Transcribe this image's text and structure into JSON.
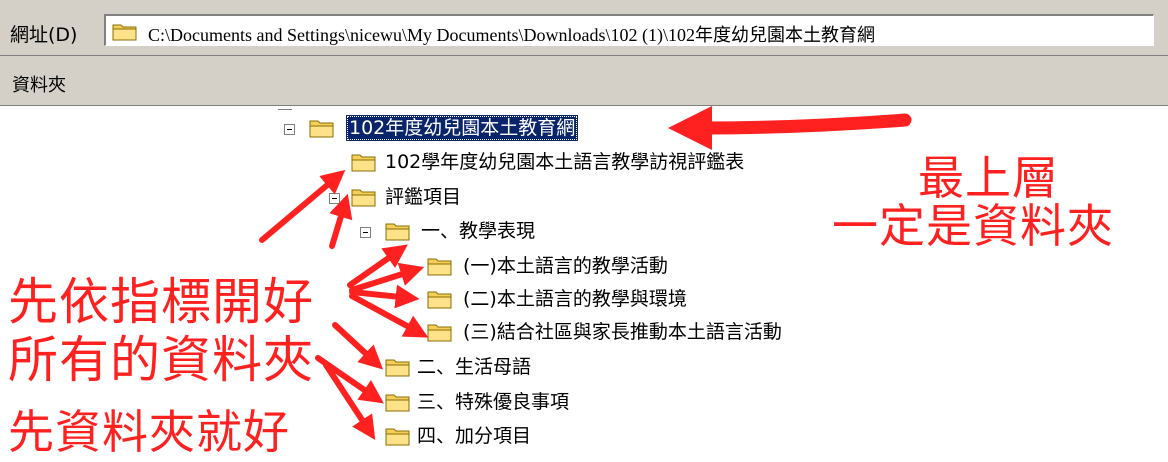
{
  "address_bar": {
    "label": "網址(D)",
    "path": "C:\\Documents and Settings\\nicewu\\My Documents\\Downloads\\102 (1)\\102年度幼兒園本土教育網"
  },
  "folders_panel": {
    "title": "資料夾"
  },
  "tree": {
    "root": "102年度幼兒園本土教育網",
    "form": "102學年度幼兒園本土語言教學訪視評鑑表",
    "eval_items": "評鑑項目",
    "teaching": "一、教學表現",
    "sub1": "(一)本土語言的教學活動",
    "sub2": "(二)本土語言的教學與環境",
    "sub3": "(三)結合社區與家長推動本土語言活動",
    "life": "二、生活母語",
    "special": "三、特殊優良事項",
    "bonus": "四、加分項目"
  },
  "annotations": {
    "top_line1": "最上層",
    "top_line2": "一定是資料夾",
    "left_line1": "先依指標開好",
    "left_line2": "所有的資料夾",
    "left_line3": "先資料夾就好"
  },
  "colors": {
    "annotation": "#ff2020",
    "selection": "#0a246a",
    "folder": "#f4cf5c"
  }
}
